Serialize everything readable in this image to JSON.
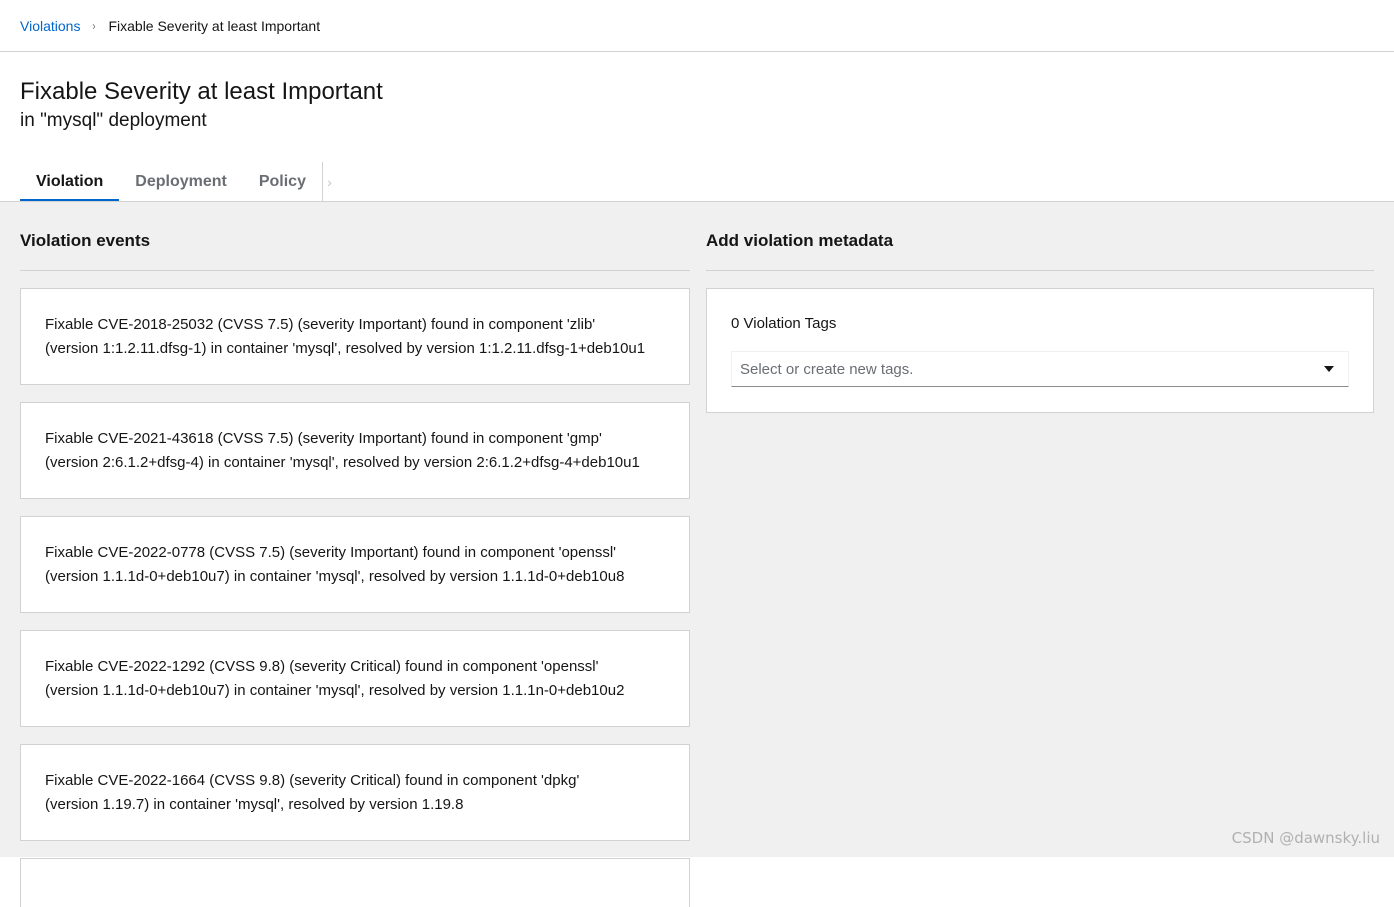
{
  "breadcrumb": {
    "parent": "Violations",
    "separator": "›",
    "current": "Fixable Severity at least Important"
  },
  "header": {
    "title": "Fixable Severity at least Important",
    "subtitle": "in \"mysql\" deployment"
  },
  "tabs": [
    {
      "label": "Violation",
      "active": true
    },
    {
      "label": "Deployment",
      "active": false
    },
    {
      "label": "Policy",
      "active": false
    }
  ],
  "tab_scroll_glyph": "›",
  "violation_events": {
    "title": "Violation events",
    "items": [
      {
        "line1": "Fixable CVE-2018-25032 (CVSS 7.5) (severity Important) found in component 'zlib'",
        "line2": "(version 1:1.2.11.dfsg-1) in container 'mysql', resolved by version 1:1.2.11.dfsg-1+deb10u1"
      },
      {
        "line1": "Fixable CVE-2021-43618 (CVSS 7.5) (severity Important) found in component 'gmp'",
        "line2": "(version 2:6.1.2+dfsg-4) in container 'mysql', resolved by version 2:6.1.2+dfsg-4+deb10u1"
      },
      {
        "line1": "Fixable CVE-2022-0778 (CVSS 7.5) (severity Important) found in component 'openssl'",
        "line2": "(version 1.1.1d-0+deb10u7) in container 'mysql', resolved by version 1.1.1d-0+deb10u8"
      },
      {
        "line1": "Fixable CVE-2022-1292 (CVSS 9.8) (severity Critical) found in component 'openssl'",
        "line2": "(version 1.1.1d-0+deb10u7) in container 'mysql', resolved by version 1.1.1n-0+deb10u2"
      },
      {
        "line1": "Fixable CVE-2022-1664 (CVSS 9.8) (severity Critical) found in component 'dpkg'",
        "line2": "(version 1.19.7) in container 'mysql', resolved by version 1.19.8"
      }
    ]
  },
  "metadata": {
    "title": "Add violation metadata",
    "tags_count": "0 Violation Tags",
    "tags_placeholder": "Select or create new tags."
  },
  "watermark": "CSDN @dawnsky.liu",
  "colors": {
    "link": "#0066cc",
    "active_tab": "#0066cc",
    "panel_bg": "#f0f0f0"
  }
}
